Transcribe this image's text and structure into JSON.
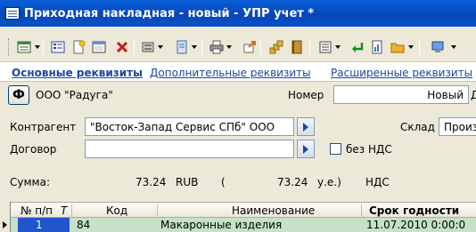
{
  "window": {
    "title": "Приходная накладная - новый - УПР учет *"
  },
  "tabs": [
    {
      "label": "Основные реквизиты"
    },
    {
      "label": "Дополнительные реквизиты"
    },
    {
      "label": "Расширенные реквизиты"
    }
  ],
  "header": {
    "f_button": "Ф",
    "organization": "ООО \"Радуга\"",
    "number_label": "Номер",
    "number_value": "Новый",
    "number_trailing": "Д"
  },
  "form": {
    "counterparty_label": "Контрагент",
    "counterparty_value": "\"Восток-Запад Сервис СПб\" ООО",
    "warehouse_label": "Склад",
    "warehouse_value": "Произ",
    "contract_label": "Договор",
    "contract_value": "",
    "no_vat_label": "без НДС",
    "no_vat_checked": false
  },
  "totals": {
    "sum_label": "Сумма:",
    "sum_value": "73.24",
    "currency": "RUB",
    "paren_open": "(",
    "ue_value": "73.24",
    "ue_label": "у.е.)",
    "vat_label": "НДС"
  },
  "grid": {
    "columns": [
      "№ п/п",
      "Т",
      "Код",
      "Наименование",
      "Срок годности"
    ],
    "rows": [
      {
        "num": "1",
        "code": "84",
        "name": "Макаронные изделия",
        "expiry": "11.07.2010 0:00:0"
      }
    ]
  },
  "colors": {
    "titlebar": "#0a5fd8",
    "link": "#1a47a0",
    "row_highlight": "#c7e0c7",
    "row_selected_cell": "#2255cc"
  }
}
